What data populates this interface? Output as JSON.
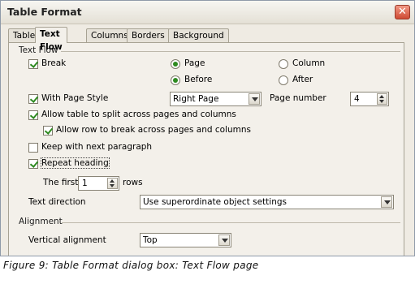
{
  "window": {
    "title": "Table Format",
    "close_label": "✕"
  },
  "tabs": [
    {
      "label": "Table",
      "active": false
    },
    {
      "label": "Text Flow",
      "active": true
    },
    {
      "label": "Columns",
      "active": false
    },
    {
      "label": "Borders",
      "active": false
    },
    {
      "label": "Background",
      "active": false
    }
  ],
  "text_flow": {
    "group_label": "Text Flow",
    "break": {
      "label": "Break",
      "checked": true
    },
    "page_option": {
      "label": "Page",
      "selected": true
    },
    "column_option": {
      "label": "Column",
      "selected": false
    },
    "before_option": {
      "label": "Before",
      "selected": true
    },
    "after_option": {
      "label": "After",
      "selected": false
    },
    "with_page_style": {
      "label": "With Page Style",
      "checked": true
    },
    "page_style_value": "Right Page",
    "page_number_label": "Page number",
    "page_number_value": "4",
    "allow_split": {
      "label": "Allow table to split across pages and columns",
      "checked": true
    },
    "allow_row_break": {
      "label": "Allow row to break across pages and columns",
      "checked": true
    },
    "keep_with_next": {
      "label": "Keep with next paragraph",
      "checked": false
    },
    "repeat_heading": {
      "label": "Repeat heading",
      "checked": true
    },
    "the_first_label": "The first",
    "the_first_value": "1",
    "rows_label": "rows",
    "text_direction_label": "Text direction",
    "text_direction_value": "Use superordinate object settings"
  },
  "alignment": {
    "group_label": "Alignment",
    "vertical_alignment_label": "Vertical alignment",
    "vertical_alignment_value": "Top"
  },
  "caption": "Figure 9: Table Format dialog box: Text Flow page"
}
